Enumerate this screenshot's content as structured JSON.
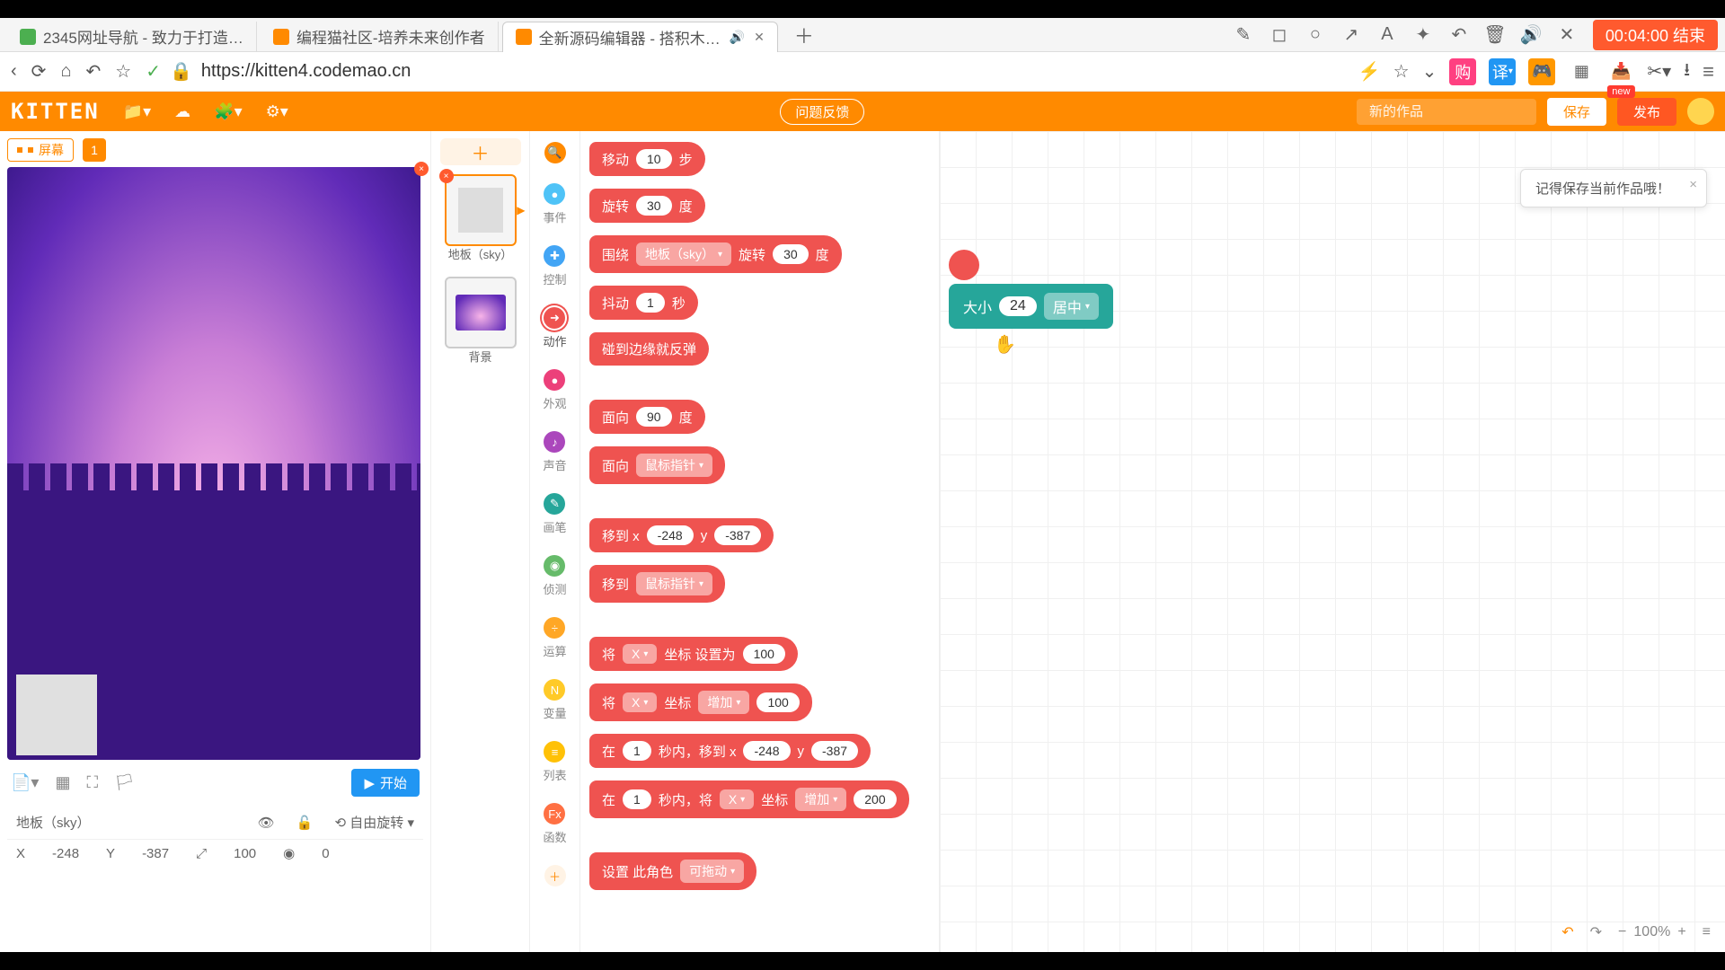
{
  "browser": {
    "tabs": [
      {
        "title": "2345网址导航 - 致力于打造…"
      },
      {
        "title": "编程猫社区-培养未来创作者"
      },
      {
        "title": "全新源码编辑器 - 搭积木…"
      }
    ],
    "url": "https://kitten4.codemao.cn",
    "timer": "00:04:00 结束",
    "new_badge": "new"
  },
  "header": {
    "logo": "KITTEN",
    "feedback": "问题反馈",
    "project_placeholder": "新的作品",
    "save": "保存",
    "publish": "发布"
  },
  "notification": {
    "text": "记得保存当前作品哦！"
  },
  "stage": {
    "screen_toggle": "屏幕",
    "screen_num": "1",
    "start": "开始",
    "sprite_name": "地板（sky）",
    "free_rotate": "自由旋转",
    "x_label": "X",
    "x_value": "-248",
    "y_label": "Y",
    "y_value": "-387",
    "size_value": "100",
    "dir_value": "0"
  },
  "sprite_list": {
    "item1_label": "地板（sky）",
    "item2_label": "背景"
  },
  "categories": {
    "events": "事件",
    "control": "控制",
    "motion": "动作",
    "looks": "外观",
    "sound": "声音",
    "pen": "画笔",
    "sensing": "侦测",
    "ops": "运算",
    "vars": "变量",
    "lists": "列表",
    "funcs": "函数"
  },
  "blocks": {
    "move": {
      "label_a": "移动",
      "arg": "10",
      "label_b": "步"
    },
    "rotate": {
      "label_a": "旋转",
      "arg": "30",
      "label_b": "度"
    },
    "orbit": {
      "label_a": "围绕",
      "target": "地板（sky）",
      "label_b": "旋转",
      "arg": "30",
      "label_c": "度"
    },
    "shake": {
      "label_a": "抖动",
      "arg": "1",
      "label_b": "秒"
    },
    "bounce": {
      "label": "碰到边缘就反弹"
    },
    "face_deg": {
      "label_a": "面向",
      "arg": "90",
      "label_b": "度"
    },
    "face_mouse": {
      "label_a": "面向",
      "target": "鼠标指针"
    },
    "goto_xy": {
      "label_a": "移到 x",
      "x": "-248",
      "label_b": "y",
      "y": "-387"
    },
    "goto_mouse": {
      "label_a": "移到",
      "target": "鼠标指针"
    },
    "set_coord": {
      "label_a": "将",
      "axis": "X",
      "label_b": "坐标 设置为",
      "val": "100"
    },
    "change_coord": {
      "label_a": "将",
      "axis": "X",
      "label_b": "坐标",
      "op": "增加",
      "val": "100"
    },
    "glide_xy": {
      "label_a": "在",
      "sec": "1",
      "label_b": "秒内，移到 x",
      "x": "-248",
      "label_c": "y",
      "y": "-387"
    },
    "glide_change": {
      "label_a": "在",
      "sec": "1",
      "label_b": "秒内，将",
      "axis": "X",
      "label_c": "坐标",
      "op": "增加",
      "val": "200"
    },
    "set_corner": {
      "label_a": "设置 此角色",
      "opt": "可拖动"
    }
  },
  "canvas_block": {
    "label_a": "大小",
    "size": "24",
    "align": "居中"
  },
  "canvas_bottom": {
    "zoom": "100%"
  }
}
